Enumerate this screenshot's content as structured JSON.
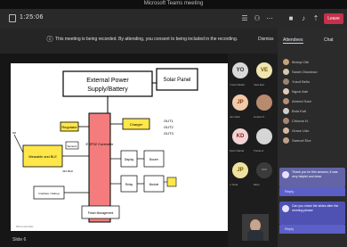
{
  "window": {
    "title": "Microsoft Teams meeting"
  },
  "toolbar": {
    "timer": "1:25:06",
    "leave_label": "Leave",
    "icons": [
      "chat-icon",
      "people-icon",
      "more-icon",
      "camera-icon",
      "mic-icon",
      "share-icon"
    ]
  },
  "banner": {
    "message": "This meeting is being recorded. By attending, you consent to being included in the recording.",
    "dismiss": "Dismiss"
  },
  "slide": {
    "external_power": "External Power",
    "supply_battery": "Supply/Battery",
    "solar_panel": "Solar Panel",
    "center_block": "ESP32 Controller",
    "regulator": "Regulator",
    "charger": "Charger",
    "left_block": "Wearable and BLE",
    "sensor_block": "Sensors",
    "radio_label": "433 MHz",
    "out1": "OUT1",
    "out2": "OUT2",
    "out3": "OUT3",
    "display": "Display",
    "buzzer": "Buzzer",
    "relay": "Relay",
    "module": "Module",
    "bottom_block": "Power Management",
    "left_bottom": "Interface / Debug",
    "footer": "Microcontroller"
  },
  "gallery": {
    "tiles": [
      {
        "initials": "YO",
        "name": "Yusuf Okafor",
        "bg": "#d9d9d9",
        "fg": "#333333"
      },
      {
        "initials": "VE",
        "name": "Vera Eze",
        "bg": "#f0e6b0",
        "fg": "#6b5a00"
      },
      {
        "initials": "JP",
        "name": "Jon Park",
        "bg": "#f3c9a8",
        "fg": "#7a3b10"
      },
      {
        "initials": "",
        "name": "Amara N.",
        "bg": "#b98b6e",
        "fg": "#ffffff"
      },
      {
        "initials": "KD",
        "name": "Kemi Daniel",
        "bg": "#f2d3d3",
        "fg": "#8a2020"
      },
      {
        "initials": "",
        "name": "Tunde A.",
        "bg": "#d6d6d6",
        "fg": "#444444"
      },
      {
        "initials": "JP",
        "name": "J. Paul",
        "bg": "#efe2a0",
        "fg": "#6d5c00"
      },
      {
        "initials": "",
        "name": "More",
        "bg": "#3b3b3b",
        "fg": "#cccccc"
      }
    ]
  },
  "panel": {
    "tabs": [
      "Attendees",
      "Chat"
    ],
    "participants": [
      "Ifeanyi Obi",
      "Sarah Okonkwo",
      "Yusuf Bello",
      "Ngozi Ade",
      "Ahmed Sani",
      "Bola Kuti",
      "Chioma N.",
      "Grace Udo",
      "Samuel Eke"
    ]
  },
  "chat": {
    "messages": [
      {
        "text": "Thank you for this session, it was very helpful and clear",
        "reply": "Reply"
      },
      {
        "text": "Can you share the slides after the meeting please",
        "reply": "Reply"
      }
    ]
  },
  "footer_label": "Slide 6"
}
